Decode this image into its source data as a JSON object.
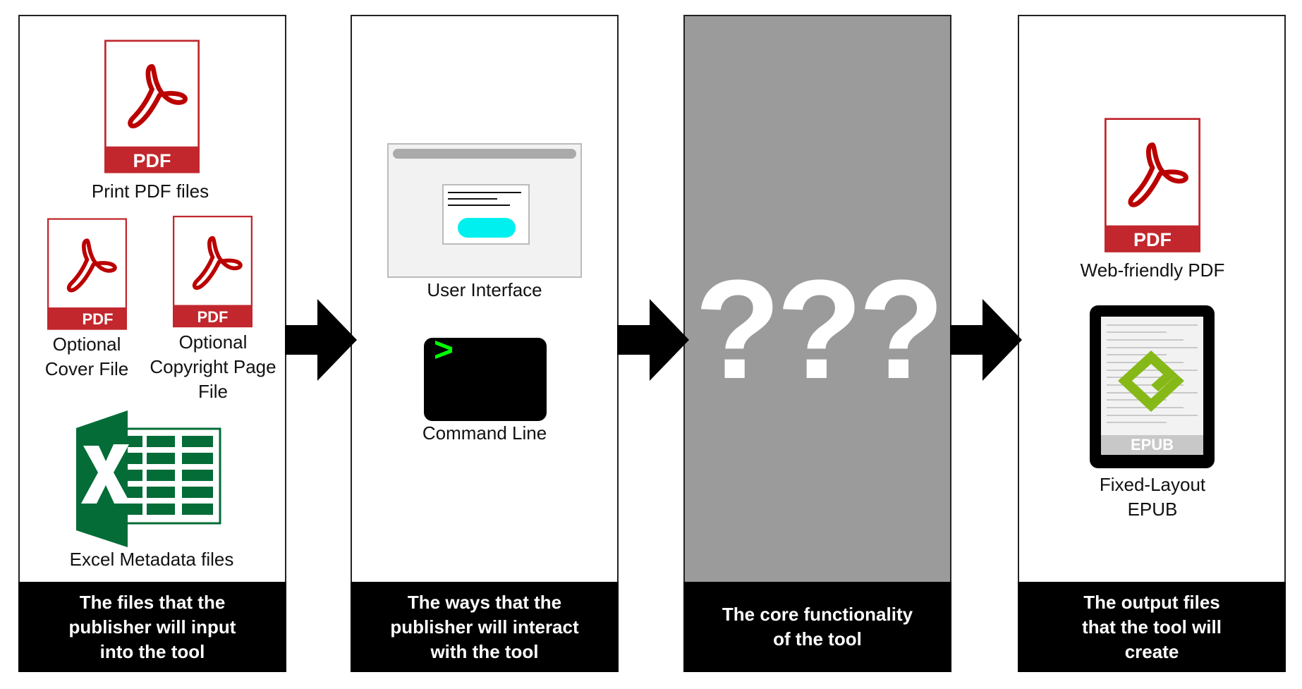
{
  "panels": [
    {
      "id": "inputs",
      "caption": "The files that the\npublisher will input\ninto the tool",
      "items": [
        {
          "icon": "pdf-icon",
          "badge": "PDF",
          "label": "Print PDF files"
        },
        {
          "icon": "pdf-icon",
          "badge": "PDF",
          "label": "Optional\nCover File"
        },
        {
          "icon": "pdf-icon",
          "badge": "PDF",
          "label": "Optional\nCopyright Page\nFile"
        },
        {
          "icon": "excel-icon",
          "label": "Excel Metadata files"
        }
      ]
    },
    {
      "id": "interfaces",
      "caption": "The ways that the\npublisher will interact\nwith the tool",
      "items": [
        {
          "icon": "user-interface-icon",
          "label": "User Interface"
        },
        {
          "icon": "terminal-icon",
          "prompt": ">",
          "label": "Command Line"
        }
      ]
    },
    {
      "id": "core",
      "caption": "The core functionality\nof the tool",
      "placeholder": "???"
    },
    {
      "id": "outputs",
      "caption": "The output files\nthat the tool will\ncreate",
      "items": [
        {
          "icon": "pdf-icon",
          "badge": "PDF",
          "label": "Web-friendly PDF"
        },
        {
          "icon": "epub-tablet-icon",
          "badge": "EPUB",
          "label": "Fixed-Layout EPUB"
        }
      ]
    }
  ],
  "colors": {
    "pdf_red": "#c1272d",
    "excel_green": "#036c37",
    "epub_green": "#86b918",
    "terminal_green": "#00ff00",
    "ui_button_cyan": "#00f0f0",
    "core_gray": "#9b9b9b"
  }
}
